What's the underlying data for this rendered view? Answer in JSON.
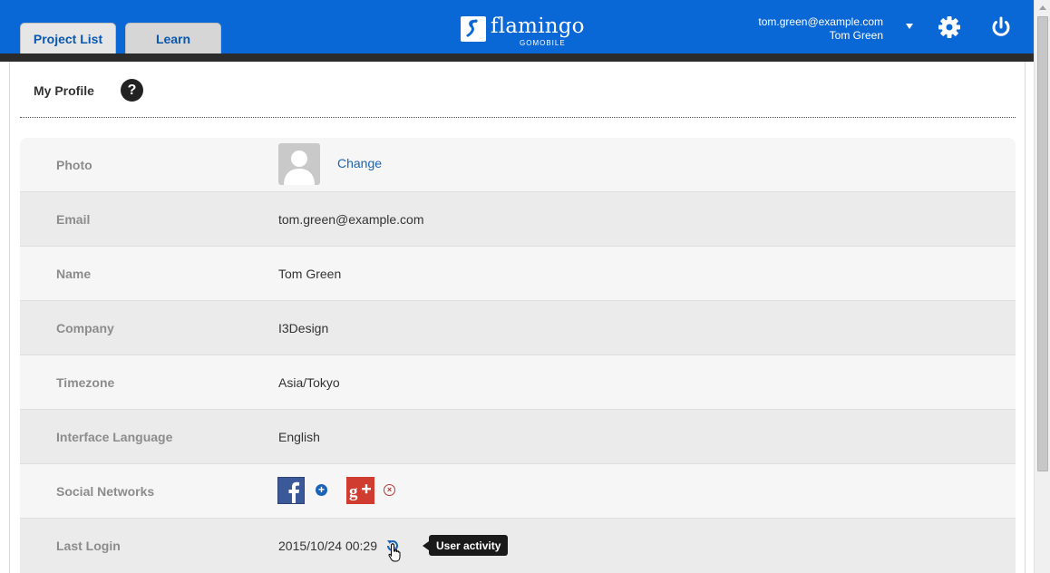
{
  "header": {
    "tabs": [
      {
        "label": "Project List"
      },
      {
        "label": "Learn"
      }
    ],
    "logo_text": "flamingo",
    "logo_sub": "GOMOBILE",
    "user_email": "tom.green@example.com",
    "user_name": "Tom Green",
    "colors": {
      "bar": "#0a67d6",
      "bar_line": "#2b2b2b"
    }
  },
  "page": {
    "title": "My Profile",
    "help_glyph": "?"
  },
  "profile": {
    "photo": {
      "label": "Photo",
      "change_label": "Change"
    },
    "email": {
      "label": "Email",
      "value": "tom.green@example.com"
    },
    "name": {
      "label": "Name",
      "value": "Tom Green"
    },
    "company": {
      "label": "Company",
      "value": "I3Design"
    },
    "timezone": {
      "label": "Timezone",
      "value": "Asia/Tokyo"
    },
    "language": {
      "label": "Interface Language",
      "value": "English"
    },
    "social": {
      "label": "Social Networks"
    },
    "last_login": {
      "label": "Last Login",
      "value": "2015/10/24 00:29",
      "tooltip": "User activity"
    }
  }
}
